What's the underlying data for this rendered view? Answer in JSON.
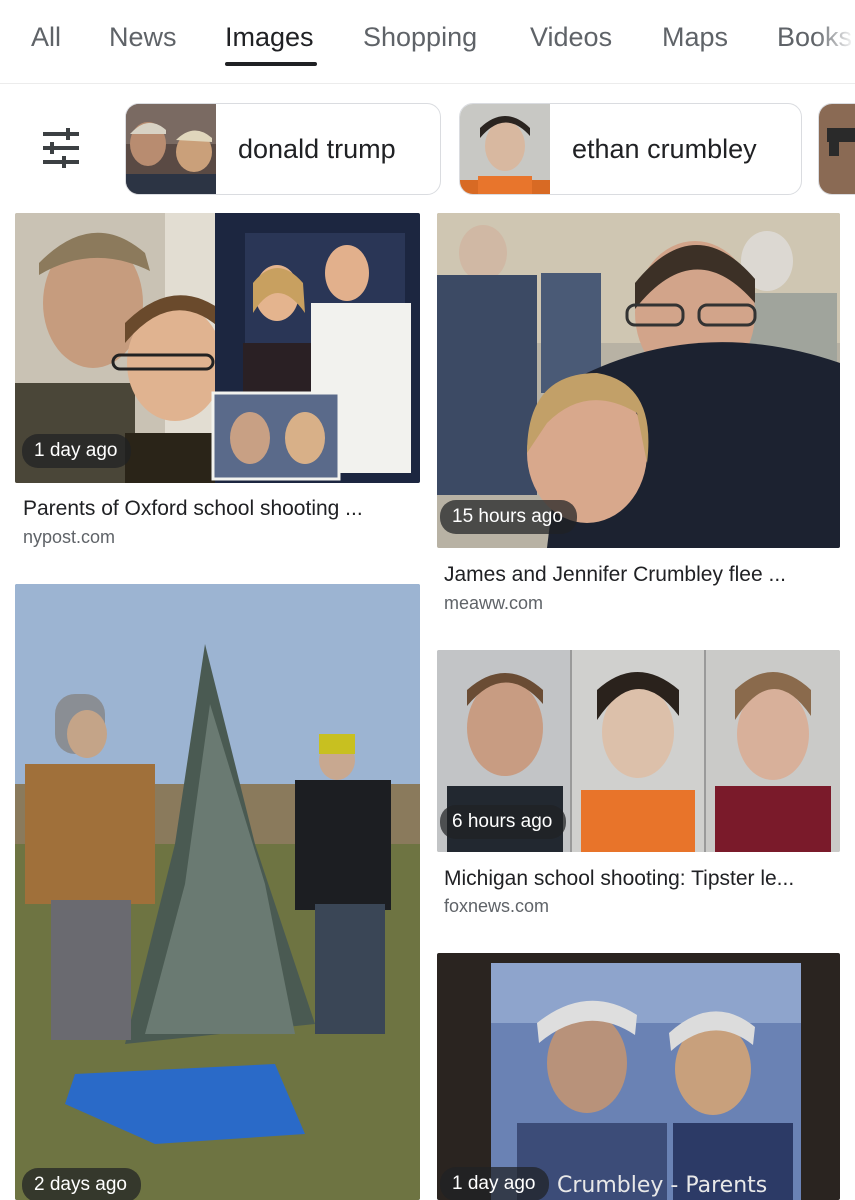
{
  "tabs": [
    {
      "label": "All",
      "active": false
    },
    {
      "label": "News",
      "active": false
    },
    {
      "label": "Images",
      "active": true
    },
    {
      "label": "Shopping",
      "active": false
    },
    {
      "label": "Videos",
      "active": false
    },
    {
      "label": "Maps",
      "active": false
    },
    {
      "label": "Books",
      "active": false
    }
  ],
  "chips": [
    {
      "label": "donald trump"
    },
    {
      "label": "ethan crumbley"
    }
  ],
  "results": [
    {
      "badge": "1 day ago",
      "title": "Parents of Oxford school shooting ...",
      "source": "nypost.com"
    },
    {
      "badge": "15 hours ago",
      "title": "James and Jennifer Crumbley flee ...",
      "source": "meaww.com"
    },
    {
      "badge": "2 days ago",
      "title": "",
      "source": ""
    },
    {
      "badge": "6 hours ago",
      "title": "Michigan school shooting: Tipster le...",
      "source": "foxnews.com"
    },
    {
      "badge": "1 day ago",
      "title": "",
      "source": "",
      "overlay_text": "Crumbley - Parents"
    }
  ],
  "colors": {
    "accent": "#202124",
    "muted": "#5f6368",
    "chip_border": "#dadce0"
  }
}
